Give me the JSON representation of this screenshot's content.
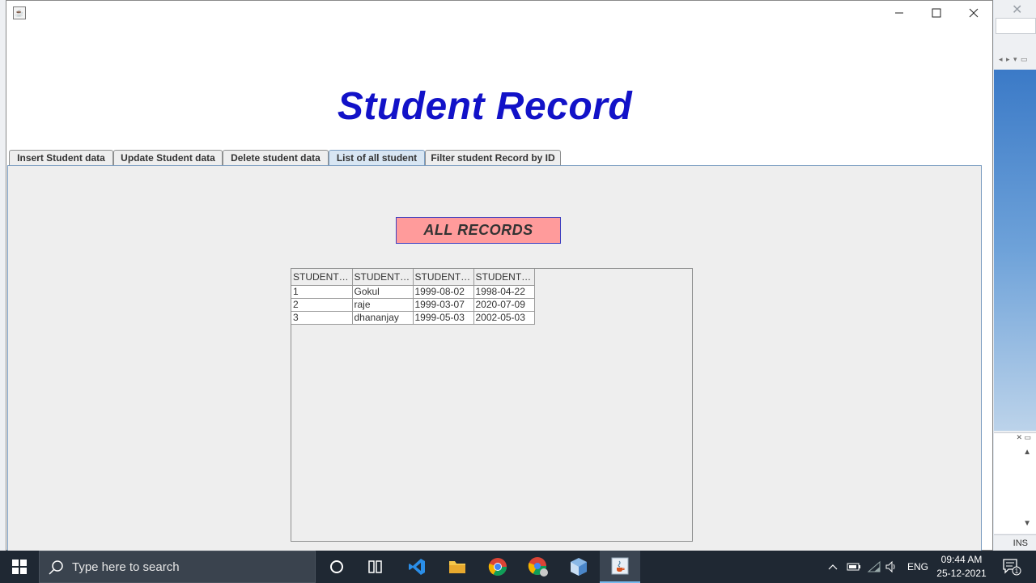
{
  "window": {
    "title": ""
  },
  "page_title": "Student Record",
  "tabs": [
    {
      "label": "Insert Student data"
    },
    {
      "label": "Update Student data"
    },
    {
      "label": "Delete student data"
    },
    {
      "label": "List of all student",
      "active": true
    },
    {
      "label": "Filter student Record by ID"
    }
  ],
  "section_label": "ALL RECORDS",
  "table": {
    "headers": [
      "STUDENT_...",
      "STUDENT_...",
      "STUDENT_...",
      "STUDENT_..."
    ],
    "rows": [
      [
        "1",
        "Gokul",
        "1999-08-02",
        "1998-04-22"
      ],
      [
        "2",
        "raje",
        "1999-03-07",
        "2020-07-09"
      ],
      [
        "3",
        "dhananjay",
        "1999-05-03",
        "2002-05-03"
      ]
    ]
  },
  "taskbar": {
    "search_placeholder": "Type here to search",
    "language": "ENG",
    "time": "09:44 AM",
    "date": "25-12-2021",
    "notification_count": "1"
  },
  "background_app": {
    "status": "INS"
  },
  "colors": {
    "title": "#1212c8",
    "records_bg": "#ff9b9b",
    "active_tab": "#d8e6f3",
    "taskbar": "#1f2833"
  }
}
